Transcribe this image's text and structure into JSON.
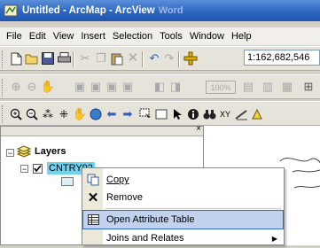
{
  "window": {
    "title": "Untitled - ArcMap - ArcView",
    "title_faded_suffix": "Word"
  },
  "menubar": {
    "items": [
      "File",
      "Edit",
      "View",
      "Insert",
      "Selection",
      "Tools",
      "Window",
      "Help"
    ]
  },
  "toolbar": {
    "scale_value": "1:162,682,546",
    "zoom_percent": "100%"
  },
  "toc": {
    "root_label": "Layers",
    "layer_label": "CNTRY92"
  },
  "context_menu": {
    "items": [
      {
        "label": "Copy",
        "icon": "copy-icon",
        "highlighted": false
      },
      {
        "label": "Remove",
        "icon": "remove-x-icon",
        "highlighted": false
      },
      {
        "label": "Open Attribute Table",
        "icon": "table-icon",
        "highlighted": true
      },
      {
        "label": "Joins and Relates",
        "icon": "",
        "highlighted": false,
        "submenu": true
      }
    ]
  },
  "colors": {
    "titlebar": "#2d66c2",
    "highlight": "#c1d2ee",
    "layer_highlight": "#6fd3f0"
  }
}
